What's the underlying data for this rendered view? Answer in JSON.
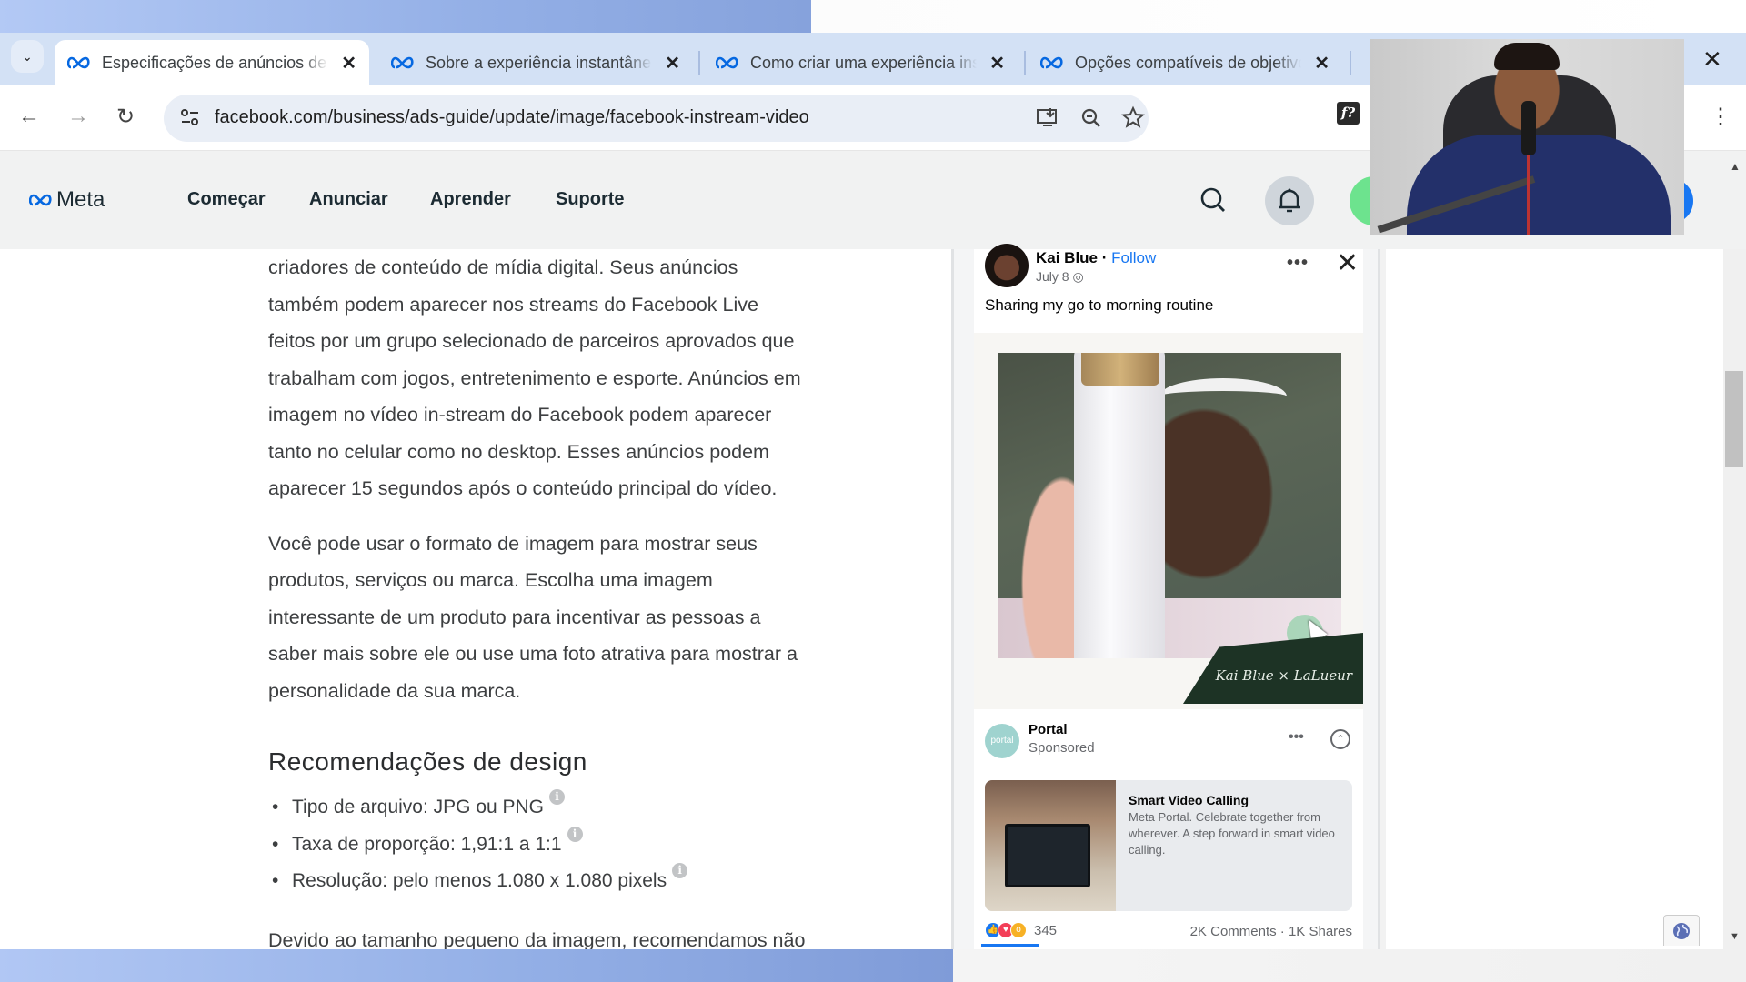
{
  "browser": {
    "tabs": [
      {
        "title": "Especificações de anúncios de c",
        "active": true
      },
      {
        "title": "Sobre a experiência instantânea",
        "active": false
      },
      {
        "title": "Como criar uma experiência ins",
        "active": false
      },
      {
        "title": "Opções compatíveis de objetivo",
        "active": false
      }
    ],
    "tab_close_glyph": "✕",
    "tab_dropdown_glyph": "⌄",
    "window_close_glyph": "✕",
    "url": "facebook.com/business/ads-guide/update/image/facebook-instream-video",
    "nav": {
      "back": "←",
      "forward": "→",
      "reload": "↻"
    },
    "extension_label": "f?",
    "menu_glyph": "⋮"
  },
  "site_nav": {
    "logo_text": "Meta",
    "items": [
      "Começar",
      "Anunciar",
      "Aprender",
      "Suporte"
    ]
  },
  "article": {
    "paragraphs": [
      [
        "criadores de conteúdo de mídia digital. Seus anúncios",
        "também podem aparecer nos streams do Facebook Live",
        "feitos por um grupo selecionado de parceiros aprovados que",
        "trabalham com jogos, entretenimento e esporte. Anúncios em",
        "imagem no vídeo in-stream do Facebook podem aparecer",
        "tanto no celular como no desktop. Esses anúncios podem",
        "aparecer 15 segundos após o conteúdo principal do vídeo."
      ],
      [
        "Você pode usar o formato de imagem para mostrar seus",
        "produtos, serviços ou marca. Escolha uma imagem",
        "interessante de um produto para incentivar as pessoas a",
        "saber mais sobre ele ou use uma foto atrativa para mostrar a",
        "personalidade da sua marca."
      ]
    ],
    "design_heading": "Recomendações de design",
    "design_specs": [
      "Tipo de arquivo: JPG ou PNG",
      "Taxa de proporção: 1,91:1 a 1:1",
      "Resolução: pelo menos 1.080 x 1.080 pixels"
    ],
    "info_glyph": "i",
    "trailing_text": "Devido ao tamanho pequeno da imagem, recomendamos não"
  },
  "preview": {
    "post": {
      "author": "Kai Blue",
      "separator": " · ",
      "follow_label": "Follow",
      "date": "July 8",
      "privacy_glyph": "◎",
      "more_glyph": "•••",
      "close_glyph": "✕",
      "caption": "Sharing my go to morning routine",
      "video_brand_text": "Kai Blue × LaLueur"
    },
    "ad": {
      "advertiser": "Portal",
      "sponsored_label": "Sponsored",
      "logo_text": "portal",
      "more_glyph": "•••",
      "collapse_glyph": "⌃",
      "card_title": "Smart Video Calling",
      "card_description": "Meta Portal. Celebrate together from wherever. A step forward in smart video calling."
    },
    "engagement": {
      "reaction_count": "345",
      "comments_shares": "2K Comments · 1K Shares"
    },
    "video_progress_fraction": 0.15
  },
  "colors": {
    "facebook_blue": "#1877f2",
    "meta_nav_bg": "#f1f2f2",
    "tab_strip_bg": "#d3e1f5",
    "brand_green": "#1d3325"
  }
}
